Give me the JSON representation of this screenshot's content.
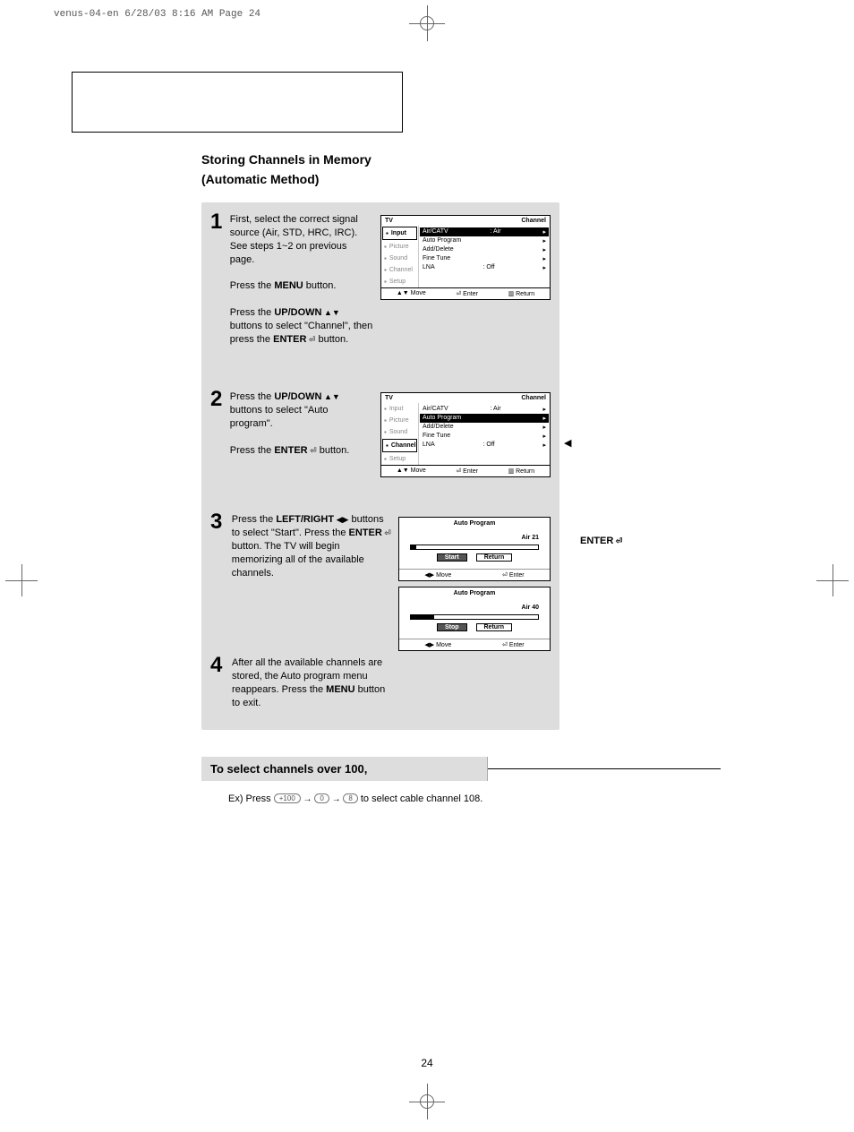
{
  "slug": "venus-04-en  6/28/03  8:16 AM  Page 24",
  "page_number": "24",
  "title": "Storing Channels in Memory",
  "subtitle": "(Automatic Method)",
  "side_caret": "◀",
  "side_enter": "ENTER",
  "steps": [
    {
      "num": "1",
      "lines": [
        "First, select the correct signal source (Air, STD, HRC, IRC). See steps 1~2 on previous page.",
        "",
        "Press the <b>MENU</b> button.",
        "",
        "Press the <b>UP/DOWN</b><span class='arrow-ud'></span> buttons to select \"Channel\", then press the <b>ENTER</b><span class='enter-glyph'></span> button."
      ]
    },
    {
      "num": "2",
      "lines": [
        "Press the <b>UP/DOWN</b><span class='arrow-ud'></span> buttons to select \"Auto program\".",
        "",
        "Press the <b>ENTER</b><span class='enter-glyph'></span> button."
      ]
    },
    {
      "num": "3",
      "lines": [
        "Press the <b>LEFT/RIGHT</b><span class='arrow-lr'></span> buttons to select \"Start\". Press the <b>ENTER</b><span class='enter-glyph'></span> button. The TV will begin  memorizing all of the available channels."
      ]
    },
    {
      "num": "4",
      "lines": [
        "After all the available channels are stored, the Auto program menu reappears. Press the <b>MENU</b> button to exit."
      ]
    }
  ],
  "osd1": {
    "tv": "TV",
    "section": "Channel",
    "side": [
      "Input",
      "Picture",
      "Sound",
      "Channel",
      "Setup"
    ],
    "side_sel": 0,
    "rows": [
      {
        "l": "Air/CATV",
        "c": ":  Air",
        "sel": true
      },
      {
        "l": "Auto Program",
        "c": ""
      },
      {
        "l": "Add/Delete",
        "c": ""
      },
      {
        "l": "Fine Tune",
        "c": ""
      },
      {
        "l": "LNA",
        "c": ":  Off"
      }
    ],
    "foot": [
      "▲▼ Move",
      "⏎ Enter",
      "▥ Return"
    ]
  },
  "osd2": {
    "tv": "TV",
    "section": "Channel",
    "side": [
      "Input",
      "Picture",
      "Sound",
      "Channel",
      "Setup"
    ],
    "side_sel": 3,
    "rows": [
      {
        "l": "Air/CATV",
        "c": ":  Air"
      },
      {
        "l": "Auto Program",
        "c": "",
        "sel": true
      },
      {
        "l": "Add/Delete",
        "c": ""
      },
      {
        "l": "Fine Tune",
        "c": ""
      },
      {
        "l": "LNA",
        "c": ":  Off"
      }
    ],
    "foot": [
      "▲▼ Move",
      "⏎ Enter",
      "▥ Return"
    ]
  },
  "osd3": {
    "title": "Auto Program",
    "channel": "Air 21",
    "fill_pct": 4,
    "btns": [
      {
        "t": "Start",
        "sel": true
      },
      {
        "t": "Return"
      }
    ],
    "foot": [
      "◀▶ Move",
      "⏎ Enter"
    ]
  },
  "osd4": {
    "title": "Auto Program",
    "channel": "Air 40",
    "fill_pct": 18,
    "btns": [
      {
        "t": "Stop",
        "sel": true
      },
      {
        "t": "Return"
      }
    ],
    "foot": [
      "◀▶ Move",
      "⏎ Enter"
    ]
  },
  "callout": {
    "heading": "To select channels over 100,",
    "prefix": "Ex) Press",
    "keys": [
      "+100",
      "0",
      "8"
    ],
    "suffix": "to select cable channel 108."
  }
}
